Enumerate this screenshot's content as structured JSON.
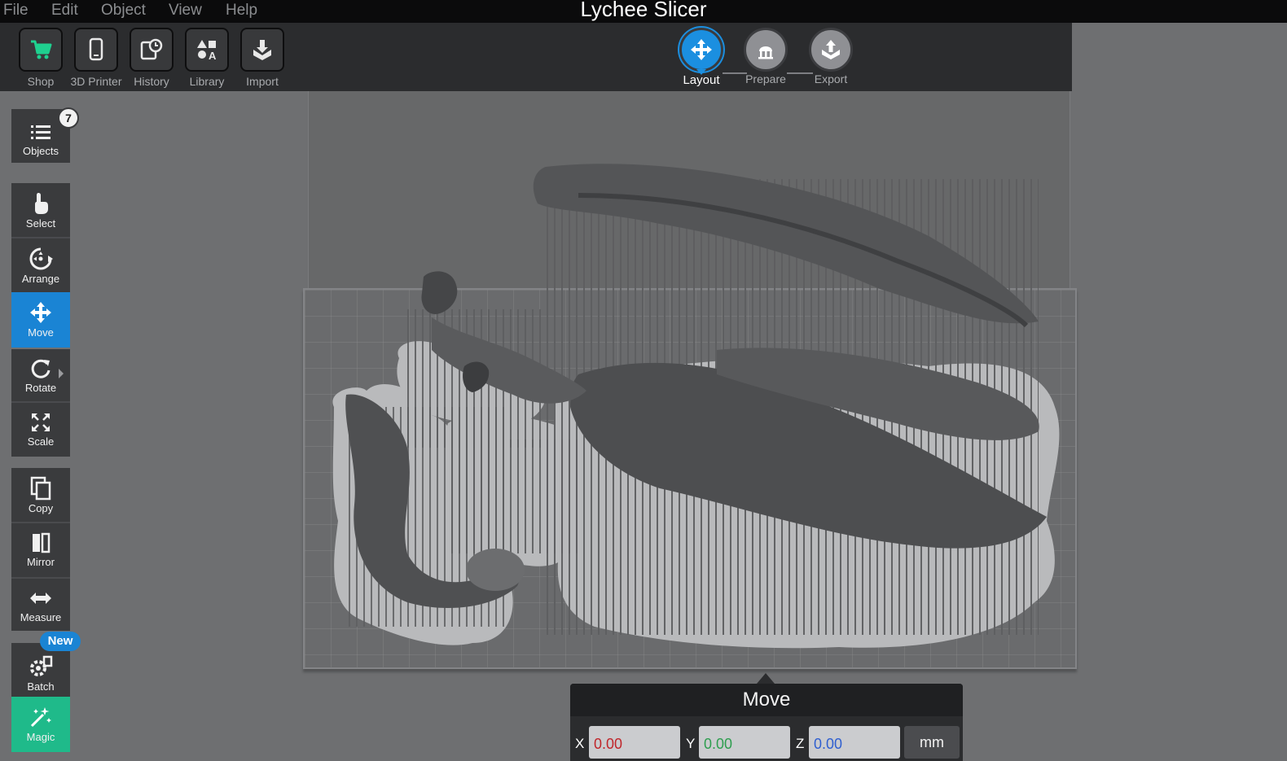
{
  "app": {
    "title": "Lychee Slicer"
  },
  "menu": {
    "items": [
      "File",
      "Edit",
      "Object",
      "View",
      "Help"
    ]
  },
  "toolbar": {
    "shop": "Shop",
    "printer": "3D Printer",
    "history": "History",
    "library": "Library",
    "import": "Import"
  },
  "workflow": {
    "steps": [
      {
        "label": "Layout",
        "active": true
      },
      {
        "label": "Prepare",
        "active": false
      },
      {
        "label": "Export",
        "active": false
      }
    ]
  },
  "sidebar": {
    "objects": {
      "label": "Objects",
      "count": "7"
    },
    "tools": {
      "select": "Select",
      "arrange": "Arrange",
      "move": "Move",
      "rotate": "Rotate",
      "scale": "Scale",
      "copy": "Copy",
      "mirror": "Mirror",
      "measure": "Measure",
      "batch": "Batch",
      "magic": "Magic"
    },
    "active_tool": "move",
    "new_badge": "New"
  },
  "move_panel": {
    "title": "Move",
    "x_label": "X",
    "y_label": "Y",
    "z_label": "Z",
    "x_value": "0.00",
    "y_value": "0.00",
    "z_value": "0.00",
    "unit": "mm"
  },
  "colors": {
    "accent_blue": "#1b8fe0",
    "magic_green": "#1fba8a",
    "shop_green": "#1fd08f",
    "x_red": "#c0262b",
    "y_green": "#2e9e4f",
    "z_blue": "#2f5fd0"
  },
  "icons": {
    "shop": "cart-icon",
    "printer": "phone-printer-icon",
    "history": "history-icon",
    "library": "shapes-icon",
    "import": "import-icon"
  }
}
